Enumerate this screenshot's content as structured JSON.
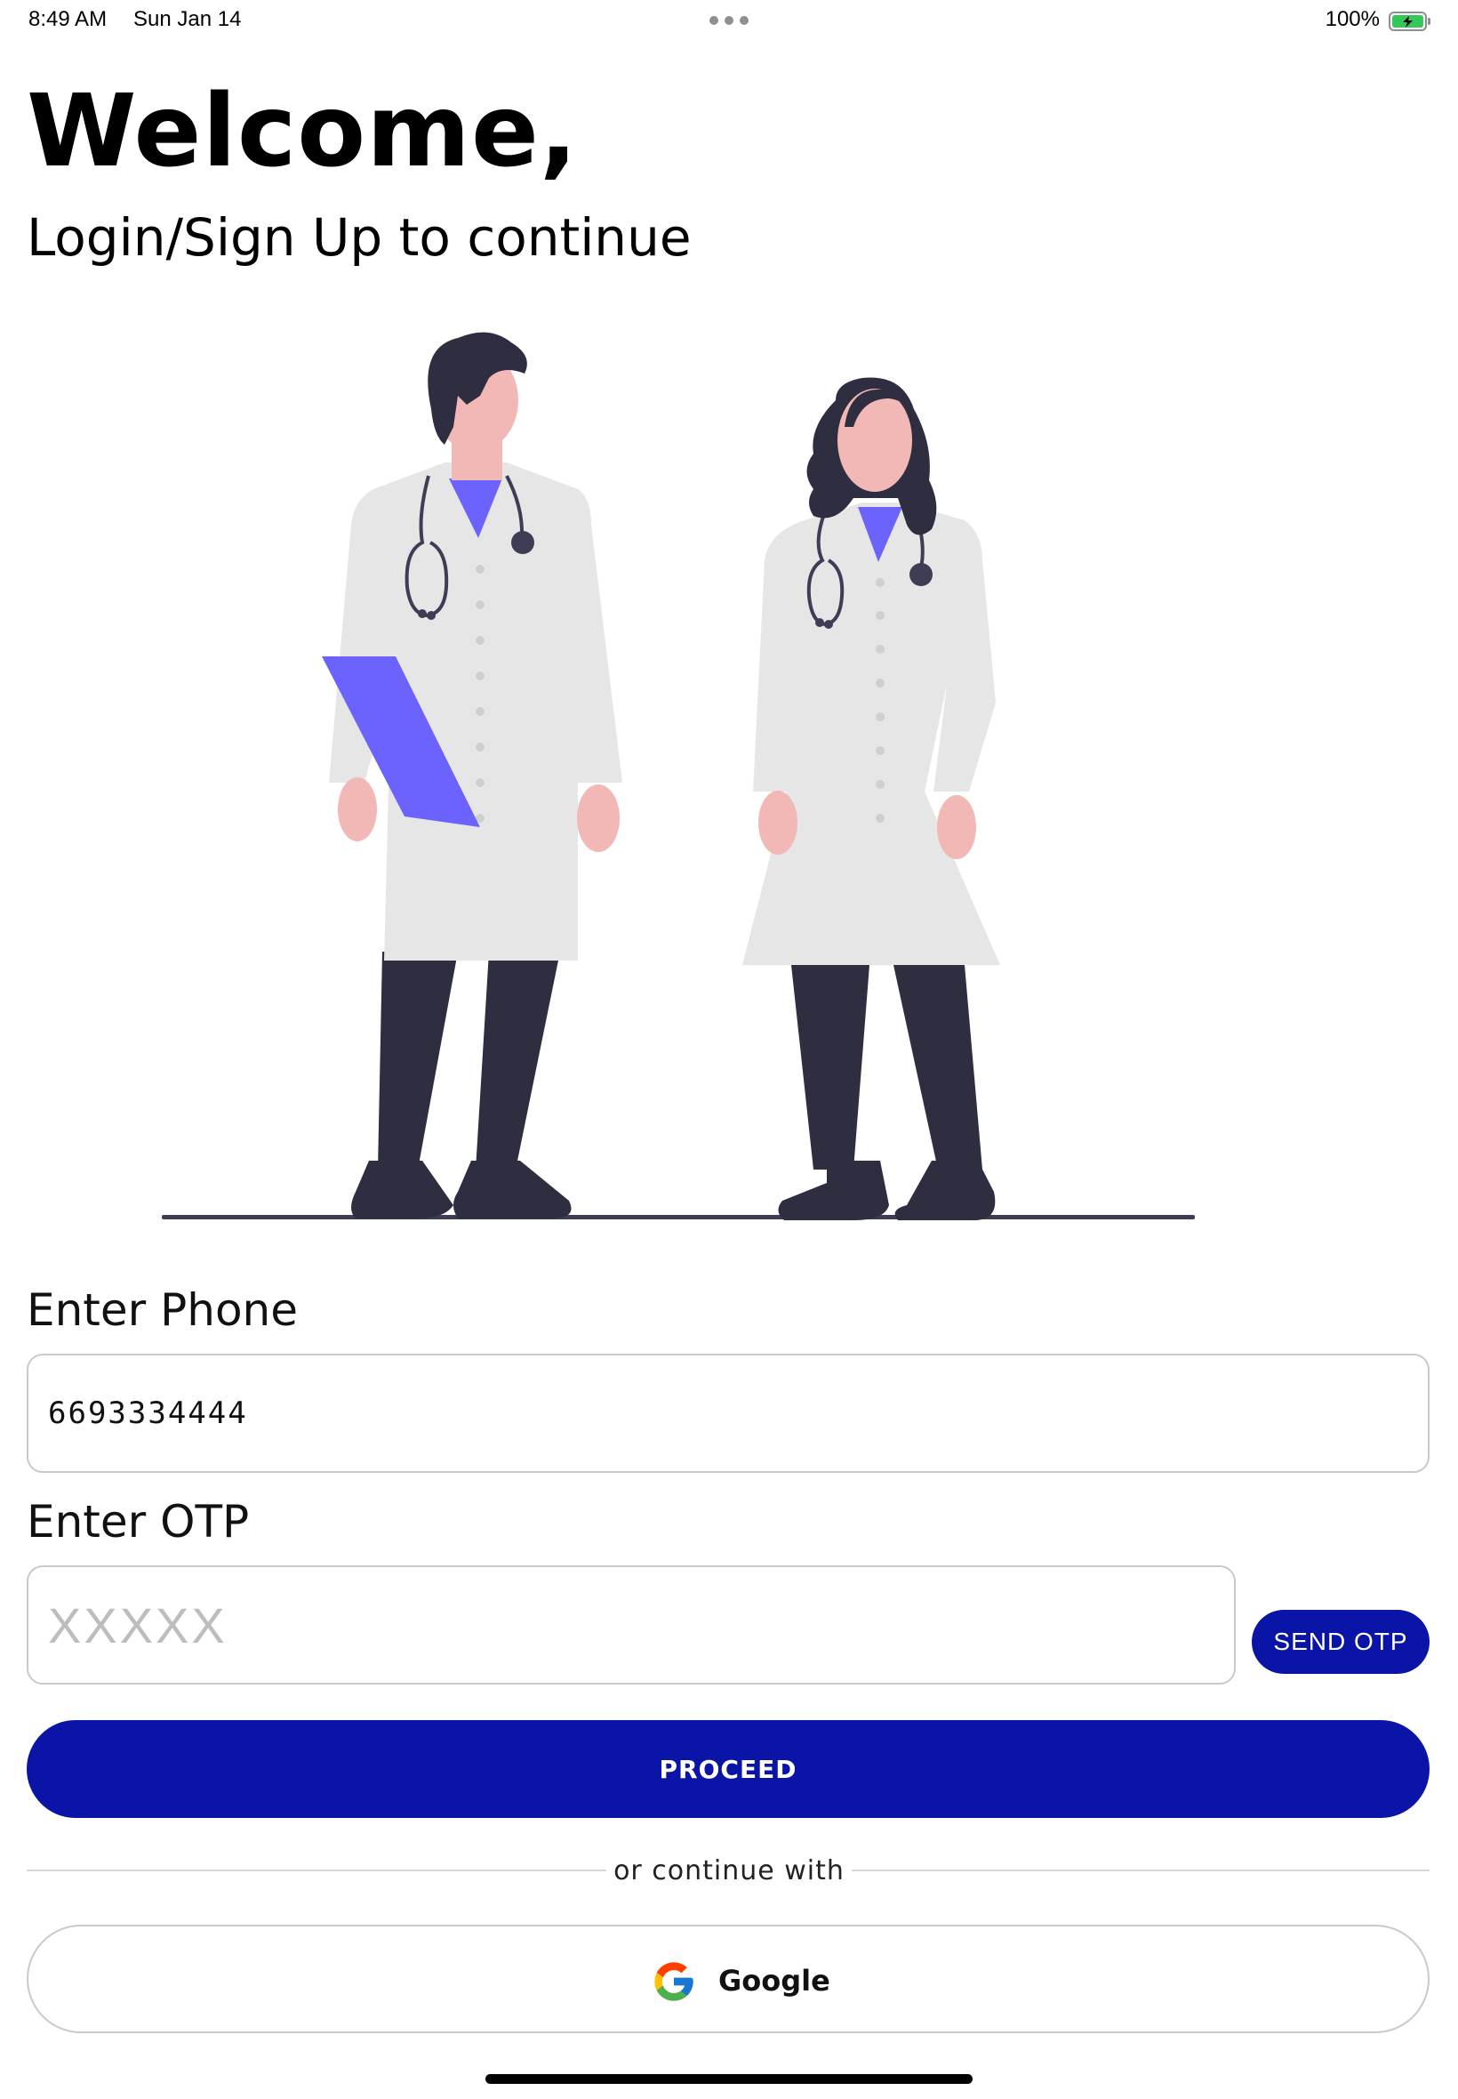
{
  "status_bar": {
    "time": "8:49 AM",
    "date": "Sun Jan 14",
    "battery_percent": "100%",
    "battery_level": 1.0,
    "battery_color": "#34c759"
  },
  "header": {
    "title": "Welcome,",
    "subtitle": "Login/Sign Up to continue"
  },
  "illustration": {
    "icon": "doctors-illustration",
    "accent_color": "#6c63ff"
  },
  "form": {
    "phone_label": "Enter Phone",
    "phone_value": "6693334444",
    "otp_label": "Enter OTP",
    "otp_placeholder": "XXXXX",
    "otp_value": "",
    "send_otp_label": "SEND OTP",
    "proceed_label": "PROCEED",
    "primary_color": "#0a14a6"
  },
  "alternate_login": {
    "divider_text": "or continue with",
    "google_label": "Google",
    "google_icon": "google-icon"
  }
}
